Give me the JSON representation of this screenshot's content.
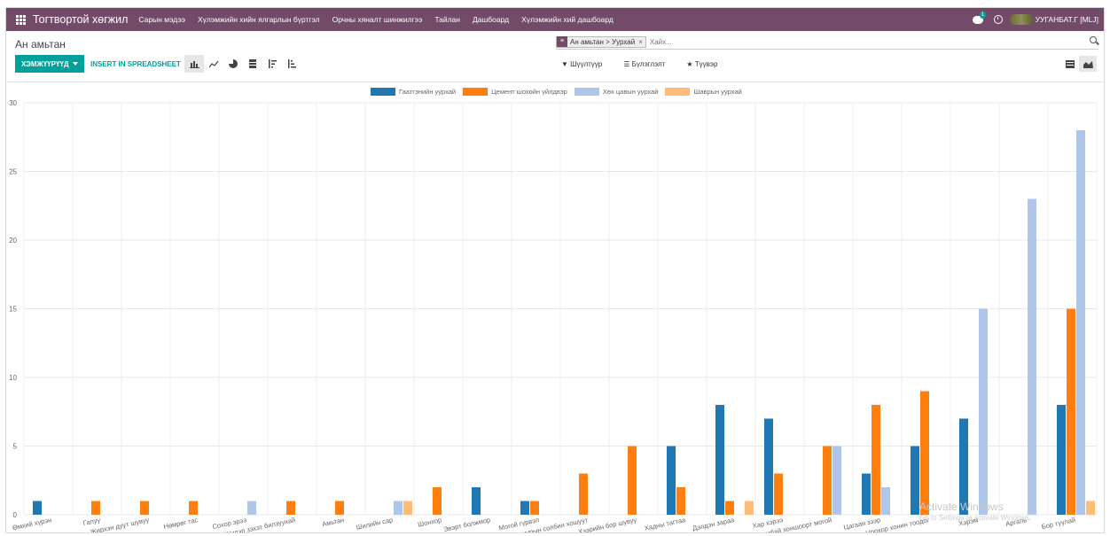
{
  "nav": {
    "brand": "Тогтвортой хөгжил",
    "menu": [
      "Сарын мэдээ",
      "Хүлэмжийн хийн ялгарлын бүртгэл",
      "Орчны хяналт шинжилгээ",
      "Тайлан",
      "Дашбоард",
      "Хүлэмжийн хий дашбоард"
    ],
    "chat_count": "1",
    "user": "УУГАНБАТ.Г [MLJ]"
  },
  "breadcrumb": "Ан амьтан",
  "search": {
    "facet": "Ан амьтан > Уурхай",
    "placeholder": "Хайх..."
  },
  "toolbar": {
    "measures_label": "ХЭМЖҮҮРҮҮД",
    "spreadsheet_label": "INSERT IN SPREADSHEET"
  },
  "filters": {
    "filter_label": "Шүүлтүүр",
    "groupby_label": "Бүлэглэлт",
    "favorites_label": "Түүвэр"
  },
  "colors": {
    "nav_bg": "#714b67",
    "accent": "#00a09d",
    "series": [
      "#1f77b4",
      "#ff7f0e",
      "#aec7e8",
      "#ffbb78"
    ]
  },
  "watermark": {
    "line1": "Activate Windows",
    "line2": "Go to Settings to activate Windows."
  },
  "chart_data": {
    "type": "bar",
    "ylim": [
      0,
      30
    ],
    "yticks": [
      0,
      5,
      10,
      15,
      20,
      25,
      30
    ],
    "grid": true,
    "legend_position": "top-center",
    "categories": [
      "Өмхий хүрэн",
      "Галуу",
      "Жирхэн дуут шувуу",
      "Нөмрөг тас",
      "Сохор эрээ",
      "Шивэр зэхэт билзуухай",
      "Амьтан",
      "Шилийн сар",
      "Шонхор",
      "Эвэрт болжмор",
      "Могой гүрвэл",
      "Гацуурын солбин хошуут",
      "Хээрийн бор шувуу",
      "Хадны тагтаа",
      "Дэлдэн зараа",
      "Хар хэрээ",
      "Бамбай хоншоорт могой",
      "Цагаан зээр",
      "Црохор хонин тоодог",
      "Хэрэм",
      "Аргаль",
      "Бор туулай"
    ],
    "series": [
      {
        "name": "Гаатгэнийн уурхай",
        "values": [
          1,
          0,
          0,
          0,
          0,
          0,
          0,
          0,
          0,
          2,
          1,
          0,
          0,
          5,
          8,
          7,
          0,
          3,
          5,
          7,
          0,
          8
        ]
      },
      {
        "name": "Цемент шохойн үйлдвэр",
        "values": [
          0,
          1,
          1,
          1,
          0,
          1,
          1,
          0,
          2,
          0,
          1,
          3,
          5,
          2,
          1,
          3,
          5,
          8,
          9,
          0,
          0,
          15
        ]
      },
      {
        "name": "Хөх цавын уурхай",
        "values": [
          0,
          0,
          0,
          0,
          1,
          0,
          0,
          1,
          0,
          0,
          0,
          0,
          0,
          0,
          0,
          0,
          5,
          2,
          0,
          15,
          23,
          28
        ]
      },
      {
        "name": "Шаврын уурхай",
        "values": [
          0,
          0,
          0,
          0,
          0,
          0,
          0,
          1,
          0,
          0,
          0,
          0,
          0,
          0,
          1,
          0,
          0,
          0,
          0,
          0,
          0,
          1
        ]
      }
    ]
  }
}
